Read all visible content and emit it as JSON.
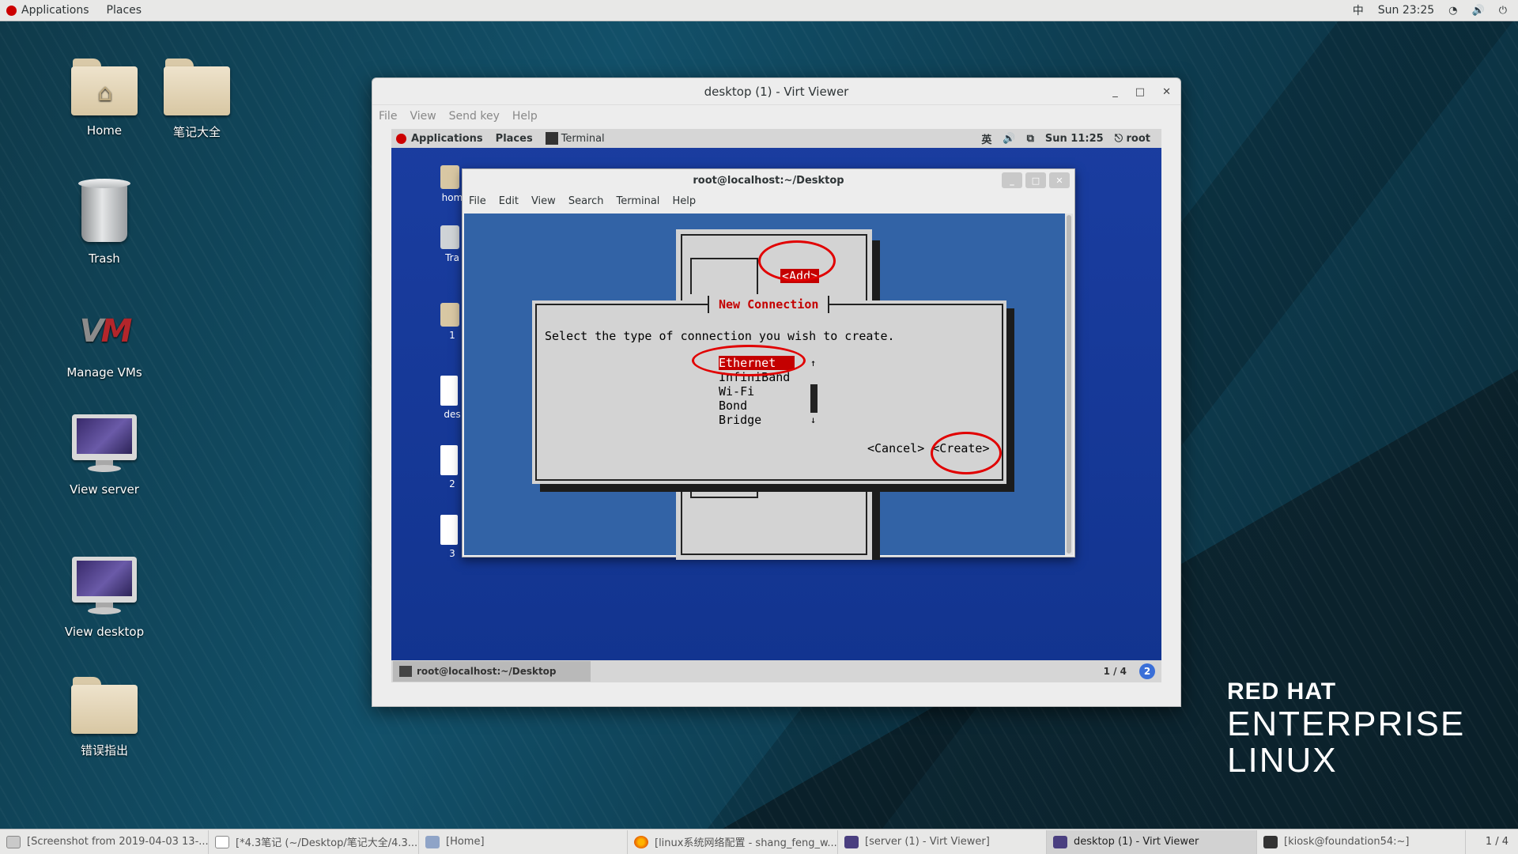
{
  "top_panel": {
    "applications": "Applications",
    "places": "Places",
    "input_method": "中",
    "clock": "Sun 23:25"
  },
  "desktop_icons": [
    {
      "label": "Home"
    },
    {
      "label": "笔记大全"
    },
    {
      "label": "Trash"
    },
    {
      "label": "Manage VMs"
    },
    {
      "label": "View server"
    },
    {
      "label": "View desktop"
    },
    {
      "label": "错误指出"
    }
  ],
  "brand": {
    "line1": "RED HAT",
    "line2": "ENTERPRISE",
    "line3": "LINUX"
  },
  "virt_viewer": {
    "title": "desktop (1) - Virt Viewer",
    "menu": [
      "File",
      "View",
      "Send key",
      "Help"
    ],
    "guest": {
      "top_panel": {
        "applications": "Applications",
        "places": "Places",
        "terminal": "Terminal",
        "input_method": "英",
        "clock": "Sun 11:25",
        "user": "root"
      },
      "desktop_icons": [
        "hom",
        "Tra",
        "1",
        "des",
        "2",
        "3"
      ],
      "bottom_task": "root@localhost:~/Desktop",
      "workspace": "1 / 4",
      "terminal": {
        "title": "root@localhost:~/Desktop",
        "menu": [
          "File",
          "Edit",
          "View",
          "Search",
          "Terminal",
          "Help"
        ],
        "nmtui": {
          "add_button": "<Add>",
          "dialog_title": "New Connection",
          "prompt": "Select the type of connection you wish to create.",
          "types": [
            "Ethernet",
            "InfiniBand",
            "Wi-Fi",
            "Bond",
            "Bridge"
          ],
          "selected": "Ethernet",
          "cancel": "<Cancel>",
          "create": "<Create>"
        }
      }
    }
  },
  "taskbar": {
    "items": [
      "[Screenshot from 2019-04-03 13-...",
      "[*4.3笔记 (~/Desktop/笔记大全/4.3...",
      "[Home]",
      "[linux系统网络配置 - shang_feng_w...",
      "[server (1) - Virt Viewer]",
      "desktop (1) - Virt Viewer",
      "[kiosk@foundation54:~]"
    ],
    "pager": "1 / 4"
  },
  "colors": {
    "annotation_red": "#e10000",
    "nmtui_highlight": "#c40000",
    "nmtui_background": "#3263a6"
  }
}
